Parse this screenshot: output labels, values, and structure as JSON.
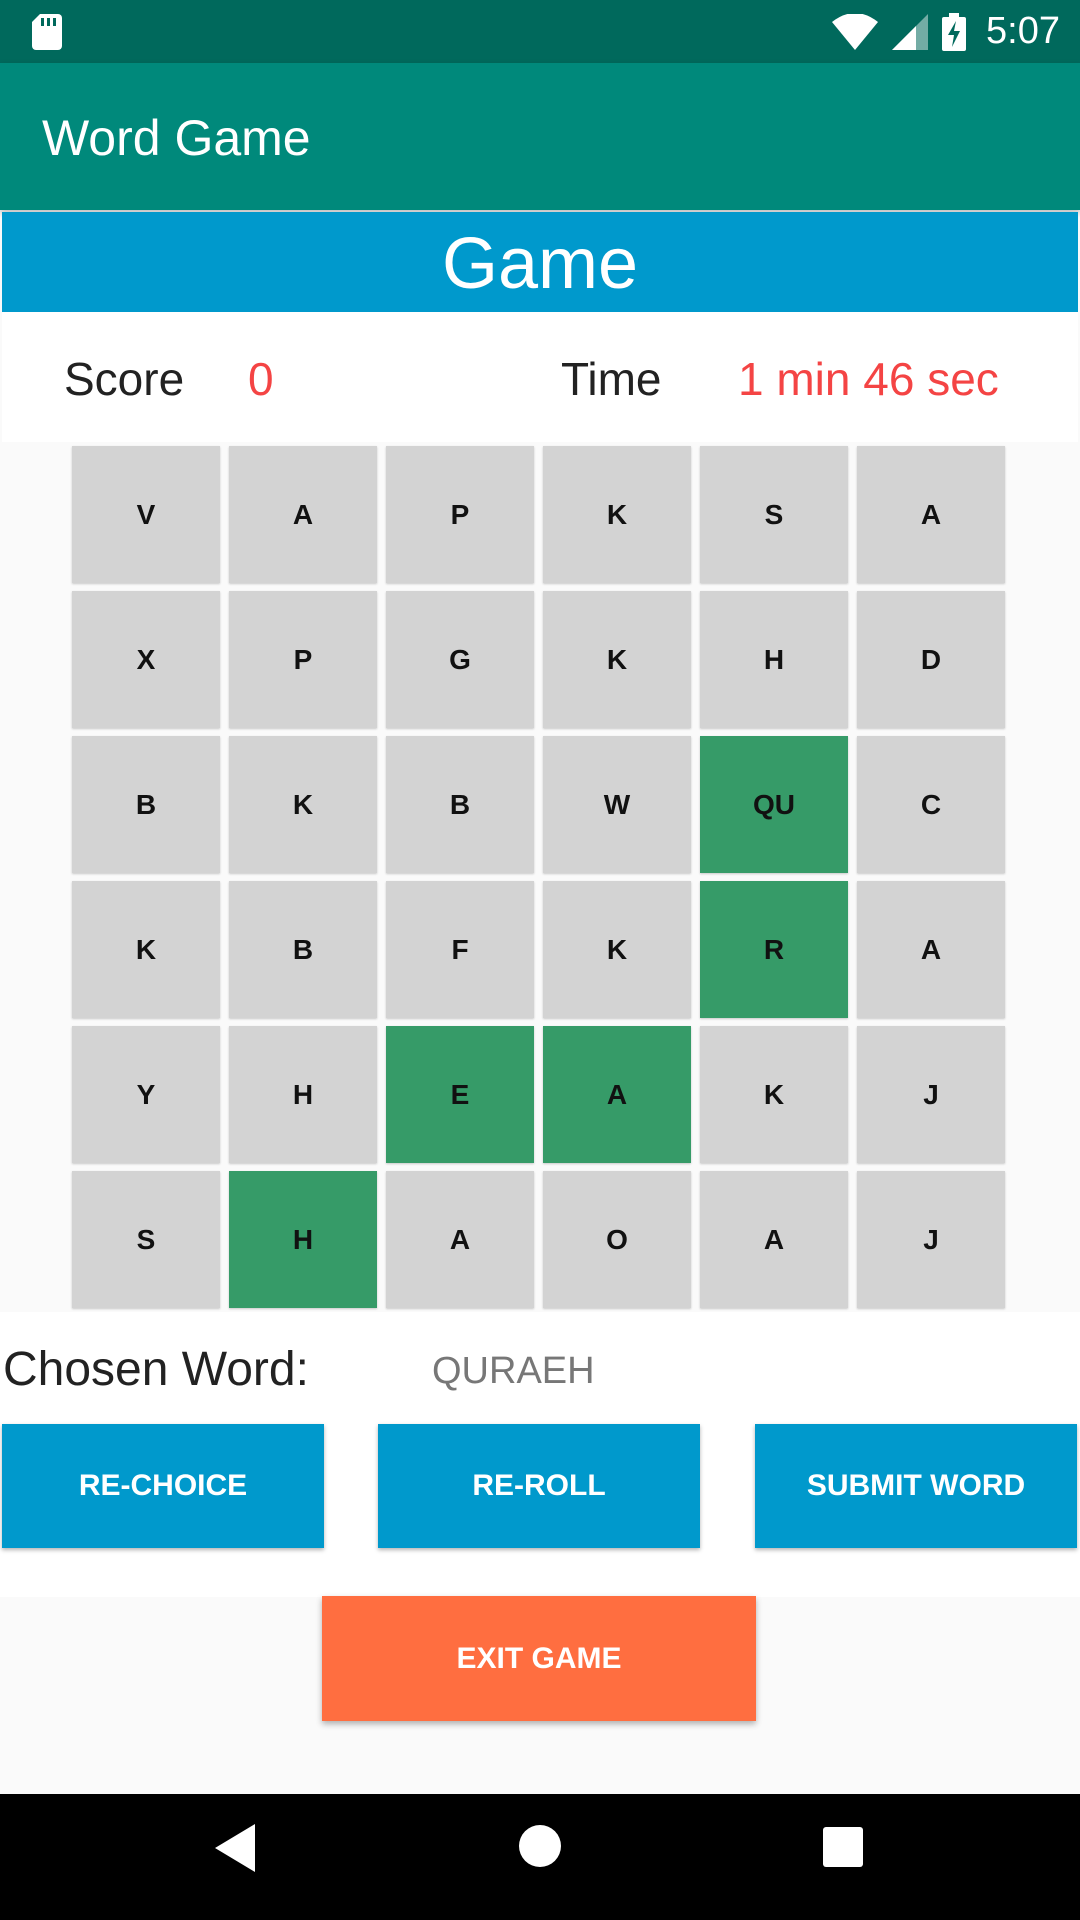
{
  "status_bar": {
    "time": "5:07"
  },
  "app_bar": {
    "title": "Word Game"
  },
  "game": {
    "header": "Game",
    "score_label": "Score",
    "score_value": "0",
    "time_label": "Time",
    "time_value": "1 min 46 sec"
  },
  "grid": {
    "rows": [
      [
        "V",
        "A",
        "P",
        "K",
        "S",
        "A"
      ],
      [
        "X",
        "P",
        "G",
        "K",
        "H",
        "D"
      ],
      [
        "B",
        "K",
        "B",
        "W",
        "QU",
        "C"
      ],
      [
        "K",
        "B",
        "F",
        "K",
        "R",
        "A"
      ],
      [
        "Y",
        "H",
        "E",
        "A",
        "K",
        "J"
      ],
      [
        "S",
        "H",
        "A",
        "O",
        "A",
        "J"
      ]
    ],
    "selected": [
      [
        2,
        4
      ],
      [
        3,
        4
      ],
      [
        4,
        2
      ],
      [
        4,
        3
      ],
      [
        5,
        1
      ]
    ]
  },
  "chosen": {
    "label": "Chosen Word:",
    "value": "QURAEH"
  },
  "buttons": {
    "rechoice": "RE-CHOICE",
    "reroll": "RE-ROLL",
    "submit": "SUBMIT WORD",
    "exit": "EXIT GAME"
  },
  "colors": {
    "status_bar": "#00695c",
    "app_bar": "#00897b",
    "accent_blue": "#0099cc",
    "tile": "#d3d3d3",
    "tile_selected": "#369b68",
    "exit": "#ff6e40",
    "highlight_text": "#f44444"
  }
}
